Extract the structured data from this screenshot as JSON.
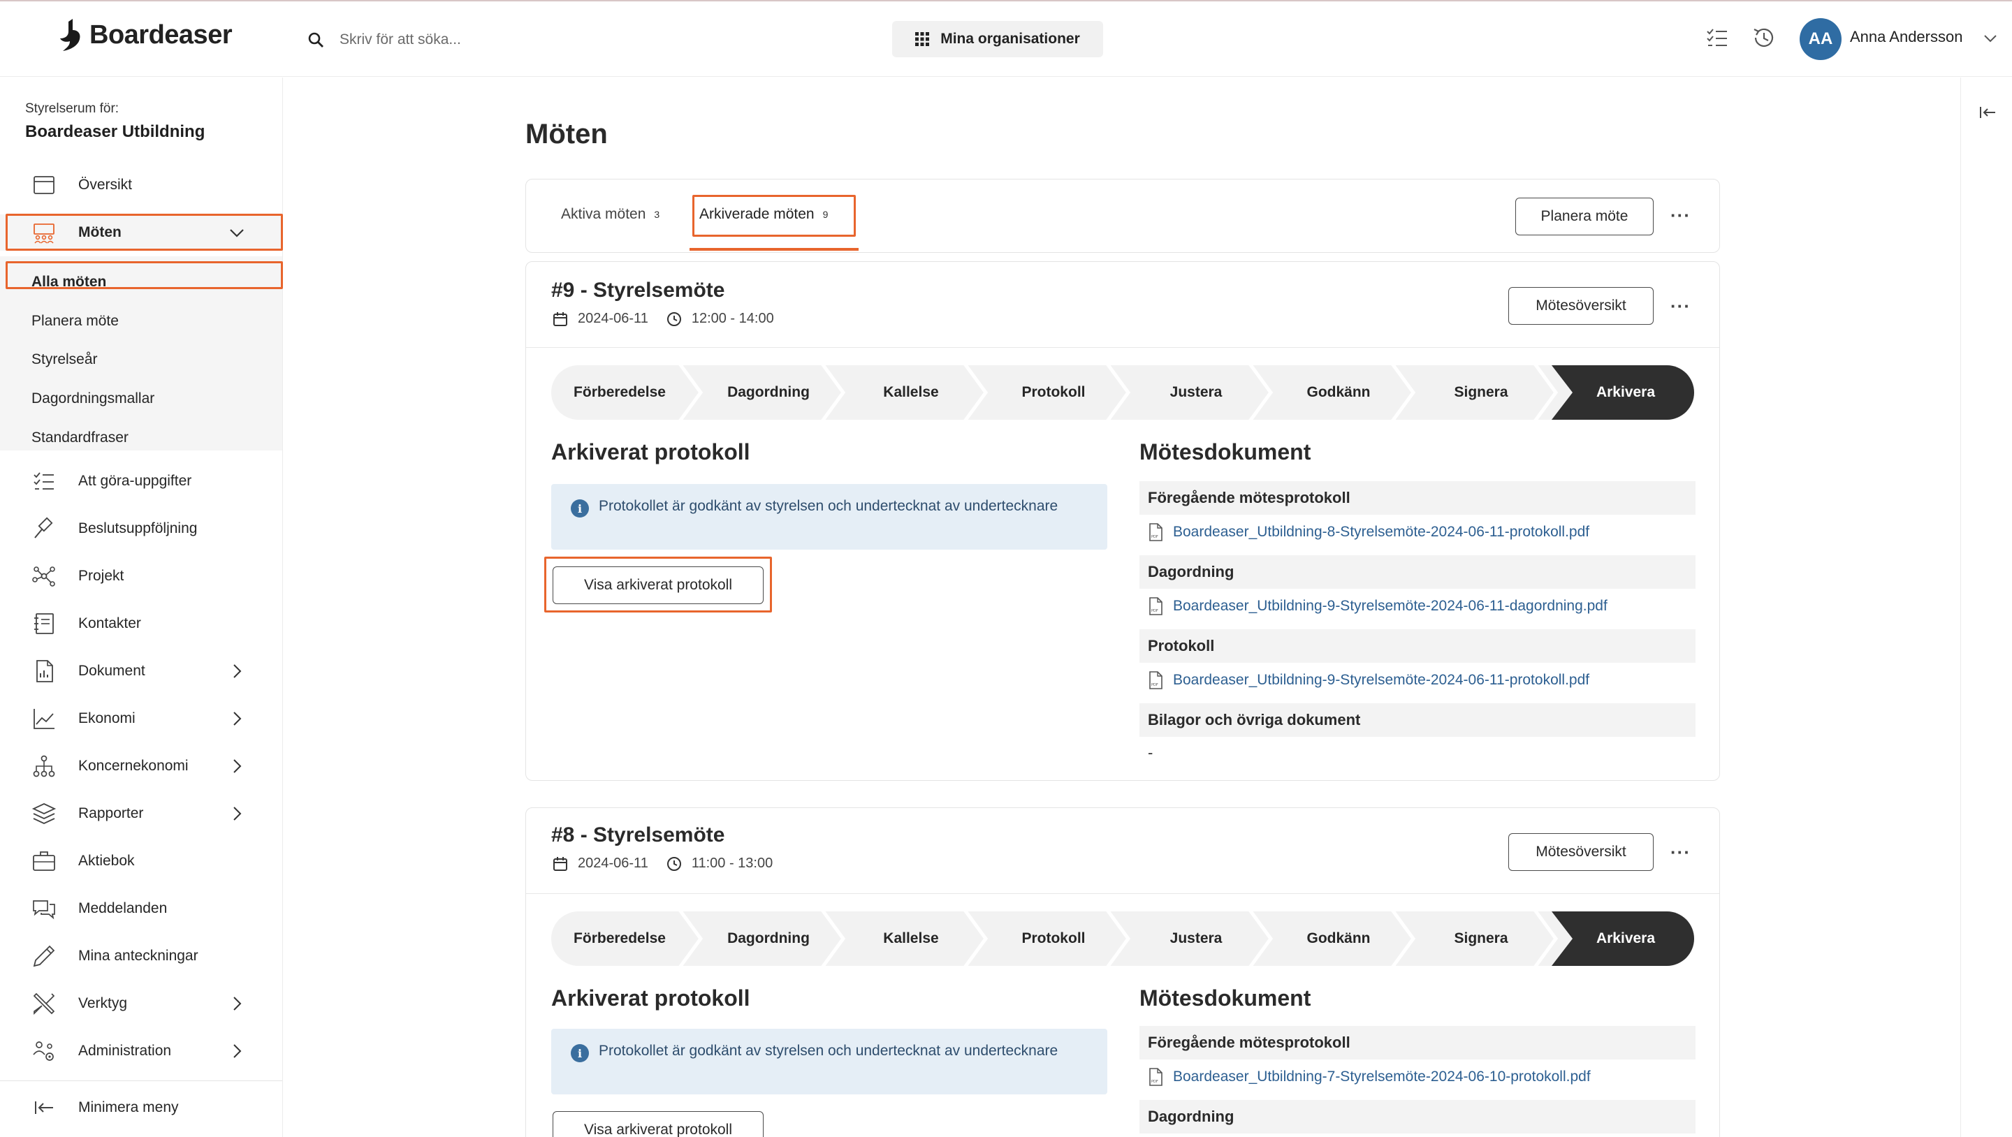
{
  "header": {
    "logo_text": "Boardeaser",
    "search_placeholder": "Skriv för att söka...",
    "orgs_label": "Mina organisationer",
    "avatar_initials": "AA",
    "user_name": "Anna Andersson"
  },
  "sidebar": {
    "caption": "Styrelserum för:",
    "org_name": "Boardeaser Utbildning",
    "items": [
      {
        "label": "Översikt",
        "icon": "calendar-icon"
      },
      {
        "label": "Möten",
        "icon": "meeting-icon"
      },
      {
        "label": "Att göra-uppgifter",
        "icon": "checklist-icon"
      },
      {
        "label": "Beslutsuppföljning",
        "icon": "gavel-icon"
      },
      {
        "label": "Projekt",
        "icon": "network-icon"
      },
      {
        "label": "Kontakter",
        "icon": "contacts-icon"
      },
      {
        "label": "Dokument",
        "icon": "document-icon"
      },
      {
        "label": "Ekonomi",
        "icon": "chart-line-icon"
      },
      {
        "label": "Koncernekonomi",
        "icon": "hierarchy-icon"
      },
      {
        "label": "Rapporter",
        "icon": "layers-icon"
      },
      {
        "label": "Aktiebok",
        "icon": "briefcase-icon"
      },
      {
        "label": "Meddelanden",
        "icon": "chat-icon"
      },
      {
        "label": "Mina anteckningar",
        "icon": "pencil-icon"
      },
      {
        "label": "Verktyg",
        "icon": "tools-icon"
      },
      {
        "label": "Administration",
        "icon": "users-gear-icon"
      }
    ],
    "sub_items": [
      "Alla möten",
      "Planera möte",
      "Styrelseår",
      "Dagordningsmallar",
      "Standardfraser"
    ],
    "minimize_label": "Minimera meny"
  },
  "main": {
    "title": "Möten",
    "tabs": [
      {
        "label": "Aktiva möten",
        "count": "3"
      },
      {
        "label": "Arkiverade möten",
        "count": "9"
      }
    ],
    "plan_button": "Planera möte",
    "more": "···",
    "meetings": [
      {
        "title": "#9 - Styrelsemöte",
        "date": "2024-06-11",
        "time": "12:00 - 14:00",
        "overview_button": "Mötesöversikt",
        "steps": [
          "Förberedelse",
          "Dagordning",
          "Kallelse",
          "Protokoll",
          "Justera",
          "Godkänn",
          "Signera",
          "Arkivera"
        ],
        "archived_heading": "Arkiverat protokoll",
        "info_text": "Protokollet är godkänt av styrelsen och undertecknat av undertecknare",
        "view_button": "Visa arkiverat protokoll",
        "docs_heading": "Mötesdokument",
        "doc_sections": [
          {
            "heading": "Föregående mötesprotokoll",
            "file": "Boardeaser_Utbildning-8-Styrelsemöte-2024-06-11-protokoll.pdf"
          },
          {
            "heading": "Dagordning",
            "file": "Boardeaser_Utbildning-9-Styrelsemöte-2024-06-11-dagordning.pdf"
          },
          {
            "heading": "Protokoll",
            "file": "Boardeaser_Utbildning-9-Styrelsemöte-2024-06-11-protokoll.pdf"
          },
          {
            "heading": "Bilagor och övriga dokument",
            "file": "-"
          }
        ]
      },
      {
        "title": "#8 - Styrelsemöte",
        "date": "2024-06-11",
        "time": "11:00 - 13:00",
        "overview_button": "Mötesöversikt",
        "steps": [
          "Förberedelse",
          "Dagordning",
          "Kallelse",
          "Protokoll",
          "Justera",
          "Godkänn",
          "Signera",
          "Arkivera"
        ],
        "archived_heading": "Arkiverat protokoll",
        "info_text": "Protokollet är godkänt av styrelsen och undertecknat av undertecknare",
        "view_button": "Visa arkiverat protokoll",
        "docs_heading": "Mötesdokument",
        "doc_sections": [
          {
            "heading": "Föregående mötesprotokoll",
            "file": "Boardeaser_Utbildning-7-Styrelsemöte-2024-06-10-protokoll.pdf"
          },
          {
            "heading": "Dagordning",
            "file": ""
          }
        ]
      }
    ]
  },
  "colors": {
    "accent_highlight": "#e8652d",
    "active_step": "#2f2f2f",
    "link": "#2d5f91",
    "info_bg": "#e5eef6",
    "avatar": "#2f6ca3"
  }
}
